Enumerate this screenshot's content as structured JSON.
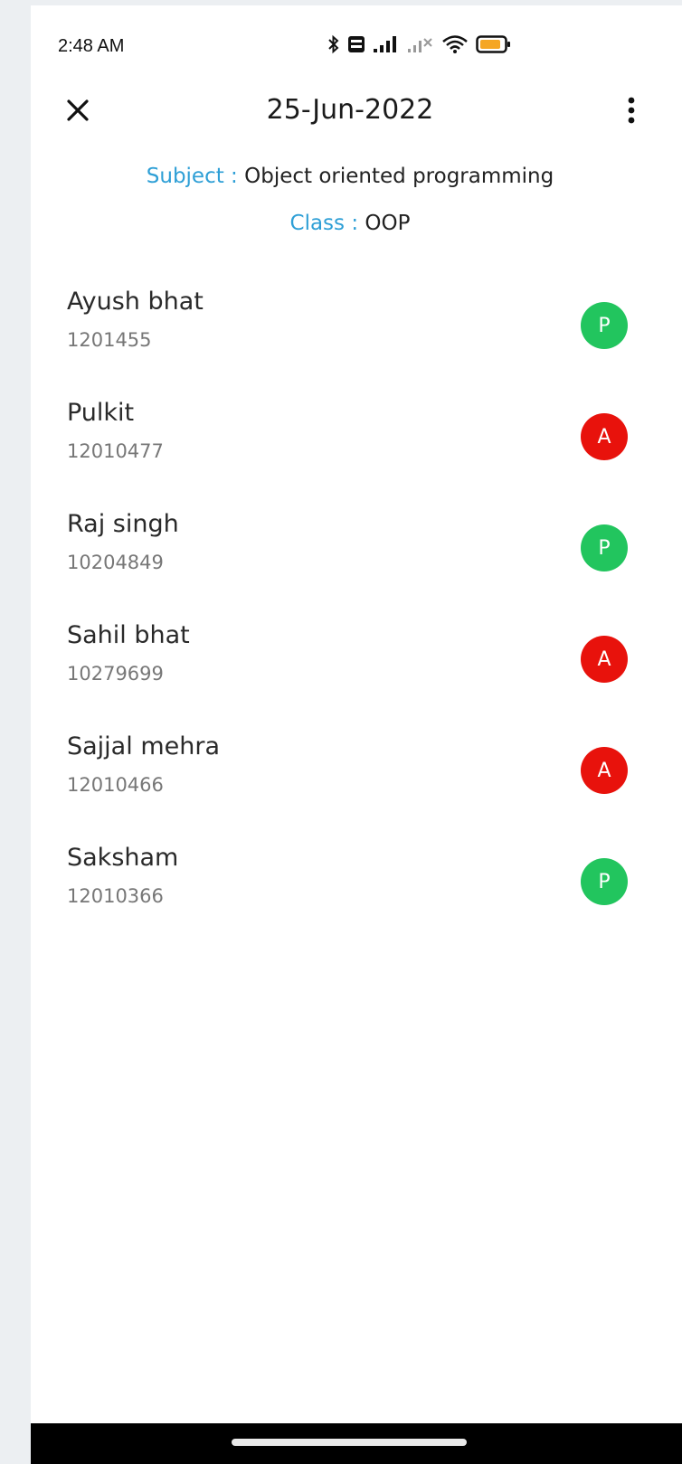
{
  "status_bar": {
    "time": "2:48 AM",
    "icons": [
      "bluetooth-icon",
      "volte-icon",
      "signal-icon",
      "signal-weak-icon",
      "wifi-icon",
      "battery-icon"
    ],
    "battery_color": "#f5a623"
  },
  "header": {
    "title": "25-Jun-2022",
    "close_icon": "close-icon",
    "menu_icon": "more-vertical-icon"
  },
  "meta": {
    "subject_label": "Subject : ",
    "subject_value": "Object oriented programming",
    "class_label": "Class : ",
    "class_value": "OOP"
  },
  "students": [
    {
      "name": "Ayush bhat",
      "id": "1201455",
      "status": "P"
    },
    {
      "name": "Pulkit",
      "id": "12010477",
      "status": "A"
    },
    {
      "name": "Raj singh",
      "id": "10204849",
      "status": "P"
    },
    {
      "name": "Sahil bhat",
      "id": "10279699",
      "status": "A"
    },
    {
      "name": "Sajjal mehra",
      "id": "12010466",
      "status": "A"
    },
    {
      "name": "Saksham",
      "id": "12010366",
      "status": "P"
    }
  ],
  "colors": {
    "present": "#22c55e",
    "absent": "#e8120c",
    "label_accent": "#2e9fd6"
  }
}
